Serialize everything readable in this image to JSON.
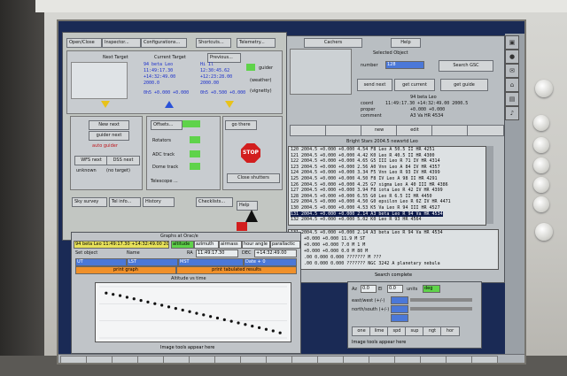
{
  "left_window": {
    "menu": [
      "Open/Close",
      "Inspector...",
      "Configurations...",
      "Shortcuts...",
      "Telemetry..."
    ],
    "next_target_label": "Next Target",
    "current_target_label": "Current Target",
    "previous_label": "Previous...",
    "current": {
      "name": "94 beta Leo",
      "ra": "11:49:17.30",
      "dec": "+14:32:49.00",
      "epoch": "2000.0",
      "offset": "0h5 +0.000 +0.000"
    },
    "previous": {
      "name": "Hi Il",
      "ra": "12:30:45.62",
      "dec": "+12:23:28.00",
      "epoch": "2000.00",
      "offset": "0h5 +0.500 +0.000"
    },
    "guider_label": "guider",
    "weather_label": "(weather)",
    "vignetty_label": "(vignetty)",
    "new_next_button": "New next",
    "guider_next_button": "guider next",
    "auto_guider_label": "auto guider",
    "wfs_next_button": "WFS next",
    "dss_next_button": "DSS next",
    "unknown_label": "unknown",
    "no_target_label": "(no target)",
    "offsets_button": "Offsets...",
    "rotators_button": "Rotators",
    "adc_track_button": "ADC track",
    "dome_track_button": "Dome track",
    "telescope_label": "Telescope ...",
    "go_there_button": "go there",
    "stop_label": "STOP",
    "close_shutters_button": "Close shutters",
    "sky_survey_button": "Sky survey",
    "tel_info_button": "Tel info...",
    "history_button": "History",
    "checklists_button": "Checklists...",
    "help_button": "Help"
  },
  "right_window": {
    "cachers_button": "Cachers",
    "help_button": "Help",
    "selected_object_label": "Selected Object",
    "number_label": "number",
    "number_value": "128",
    "search_gsc_button": "Search GSC",
    "send_next_button": "send next",
    "get_current_button": "get current",
    "get_guide_button": "get guide",
    "name_value": "94 beta Leo",
    "coord_label": "coord",
    "coord_value": "11:49:17.30  +14:32:49.00  2000.5",
    "proper_motion_label": "proper",
    "proper_motion_value": "+0.000  +0.000",
    "comment_label": "comment",
    "comment_value": "A3 Va  HR 4534",
    "mid_buttons": [
      "",
      "",
      "new",
      "edit",
      "",
      ""
    ],
    "list_title": "Bright Stars 2004.5 newsrtd Leo",
    "list_rows": [
      "120  2004.5 +0.000 +0.000 4.54 F8   Leo A 50.5 II  HR 4251",
      "121  2004.5 +0.000 +0.000 4.42 K0   Leo R 40.5 II  HR 4300",
      "122  2004.5 +0.000 +0.000 4.65 G5 III Leo R 71 IV  HR 4314",
      "123  2004.5 +0.000 +0.000 2.56 A0 Vnn Leo A 84 IV   HR 4357",
      "124  2004.5 +0.000 +0.000 3.34 F5 Vnn Leo R 93 IV  HR 4399",
      "125  2004.5 +0.000 +0.000 4.50 F8 IV Leo A 98 II  HR 4291",
      "126  2004.5 +0.000 +0.000 4.25 G7 sigma Leo A 40 III  HR 4386",
      "127  2004.5 +0.000 +0.000 3.94 F8 iota Leo R 42 IV  HR 4399",
      "128  2004.5 +0.000 +0.000 6.55 G0 Leo R 6.5 II  HR 4450",
      "129  2004.5 +0.000 +0.000 4.50 G0 epsilon Leo R 6Z IV  HR 4471",
      "130  2004.5 +0.000 +0.000 4.53 K5 Va Leo R 94 III  HR 4527",
      "131  2004.5 +0.000 +0.000 2.14 A3 beta Leo R 94 Va   HR 4534",
      "132  2004.5 +0.000 +0.000 5.02 K0 Leo R 93  HR 4564"
    ],
    "lower_rows": [
      "131  2004.5 +0.000 +0.000  2.14 A3 beta  Leo R 94 Va  HR 4534",
      "      2000 +0.000 +0.000  11.9 M  ST",
      "      2000 +0.000 +0.000   7.0 M  1 M",
      "      2000 +0.000 +0.000  0.0 M  80 M",
      "      2000 .00  0.000  0.000  ???????  M  ???",
      "      1950 .00  0.000  0.000  ???????  NGC 3242 A planetary nebula"
    ],
    "search_complete": "Search complete"
  },
  "graph_window": {
    "title": "Graphs at Orac/e",
    "target_field": "94 beta Leo  11:49:17.30 +14:32:49.00 2004.5",
    "tabs": [
      "altitude",
      "azimuth",
      "airmass",
      "hour angle",
      "parallactic"
    ],
    "set_object_label": "Set object",
    "name_label": "Name",
    "ra_label": "RA",
    "dec_label": "DEC",
    "ra_value": "11:49:17.30",
    "dec_value": "+14:32:49.00",
    "row3": [
      "UT",
      "LST",
      "MST",
      "Date + 0"
    ],
    "print_graph_button": "print graph",
    "print_tabulated_button": "print tabulated results",
    "chart_title": "Altitude vs time",
    "status": "Image tools appear here"
  },
  "small_window": {
    "row1_labels": [
      "Az",
      "0.0",
      "El",
      "0.0",
      "units",
      "deg"
    ],
    "row2_label": "east/west (+/-)",
    "row3_label": "north/south (+/-)",
    "row4_label": "",
    "buttons": [
      "one",
      "lime",
      "spd",
      "sup",
      "ngt",
      "hor"
    ],
    "status": "Image tools appear here"
  },
  "taskbar": [
    "",
    "",
    "",
    "",
    "",
    "",
    "",
    "",
    "",
    "",
    "",
    "",
    "",
    "",
    "",
    "",
    ""
  ],
  "chart_data": {
    "type": "scatter",
    "title": "Altitude vs time",
    "x": [
      0,
      1,
      2,
      3,
      4,
      5,
      6,
      7,
      8,
      9,
      10,
      11,
      12,
      13,
      14,
      15,
      16,
      17,
      18,
      19,
      20,
      21,
      22,
      23,
      24,
      25
    ],
    "y": [
      80,
      78,
      76,
      73.5,
      71,
      68.5,
      66,
      63.5,
      61,
      58.5,
      56,
      53.5,
      51,
      48.5,
      46,
      43.5,
      41,
      38.5,
      36,
      33.5,
      31,
      28.5,
      26,
      23.5,
      21,
      18
    ],
    "ylim": [
      10,
      90
    ],
    "xlim": [
      -1,
      26
    ]
  },
  "colors": {
    "screen_bg": "#1a2a55",
    "window_bg": "#b9bec2",
    "green_field": "#5fd34a",
    "orange_bar": "#f0902a",
    "blue_field": "#4b78d8"
  }
}
